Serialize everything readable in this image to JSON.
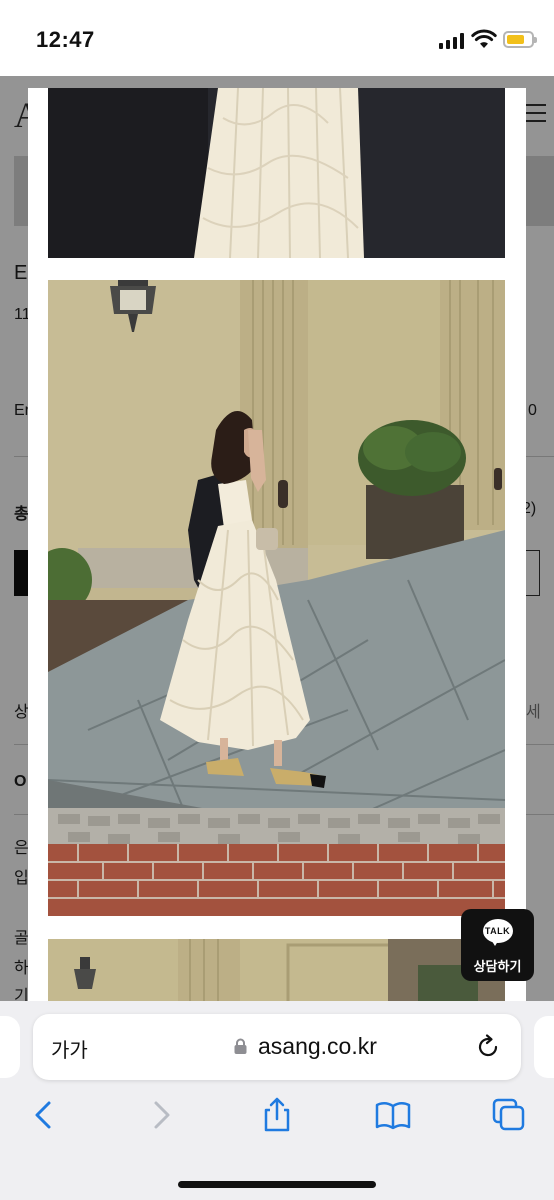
{
  "status_bar": {
    "time": "12:47",
    "battery_level": 0.75,
    "battery_color": "#f2c01a"
  },
  "background_page": {
    "fragments": [
      "A",
      "E",
      "11",
      "Er",
      "0",
      "총",
      "2)",
      "상",
      "세",
      "O",
      "은",
      "입",
      "골",
      "하",
      "기"
    ]
  },
  "chat_button": {
    "badge": "TALK",
    "label": "상담하기"
  },
  "address_bar": {
    "reader_label": "가가",
    "url": "asang.co.kr"
  },
  "toolbar": {
    "items": [
      "back-icon",
      "forward-icon",
      "share-icon",
      "bookmarks-icon",
      "tabs-icon"
    ]
  },
  "colors": {
    "accent": "#1f7ae0",
    "overlay": "rgba(0,0,0,0.42)",
    "skirt": "#f1ead8"
  }
}
